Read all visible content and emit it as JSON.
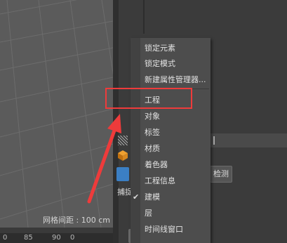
{
  "viewport": {
    "grid_spacing_label": "网格间距 : 100 cm"
  },
  "timeline": {
    "ticks": [
      "0",
      "85",
      "90",
      "0"
    ]
  },
  "left_panel": {
    "snap_label": "捕捉"
  },
  "right_panel": {
    "button_label": "检测"
  },
  "context_menu": {
    "items": [
      {
        "label": "锁定元素",
        "checked": false
      },
      {
        "label": "锁定模式",
        "checked": false
      },
      {
        "label": "新建属性管理器...",
        "checked": false
      },
      {
        "label": "工程",
        "checked": false
      },
      {
        "label": "对象",
        "checked": false
      },
      {
        "label": "标签",
        "checked": false
      },
      {
        "label": "材质",
        "checked": false
      },
      {
        "label": "着色器",
        "checked": false
      },
      {
        "label": "工程信息",
        "checked": false
      },
      {
        "label": "建模",
        "checked": true
      },
      {
        "label": "层",
        "checked": false
      },
      {
        "label": "时间线窗口",
        "checked": false
      }
    ]
  },
  "colors": {
    "annotation": "#ee3b3b",
    "menu_bg": "#4d4d4d",
    "viewport_bg": "#5b5b5b"
  }
}
